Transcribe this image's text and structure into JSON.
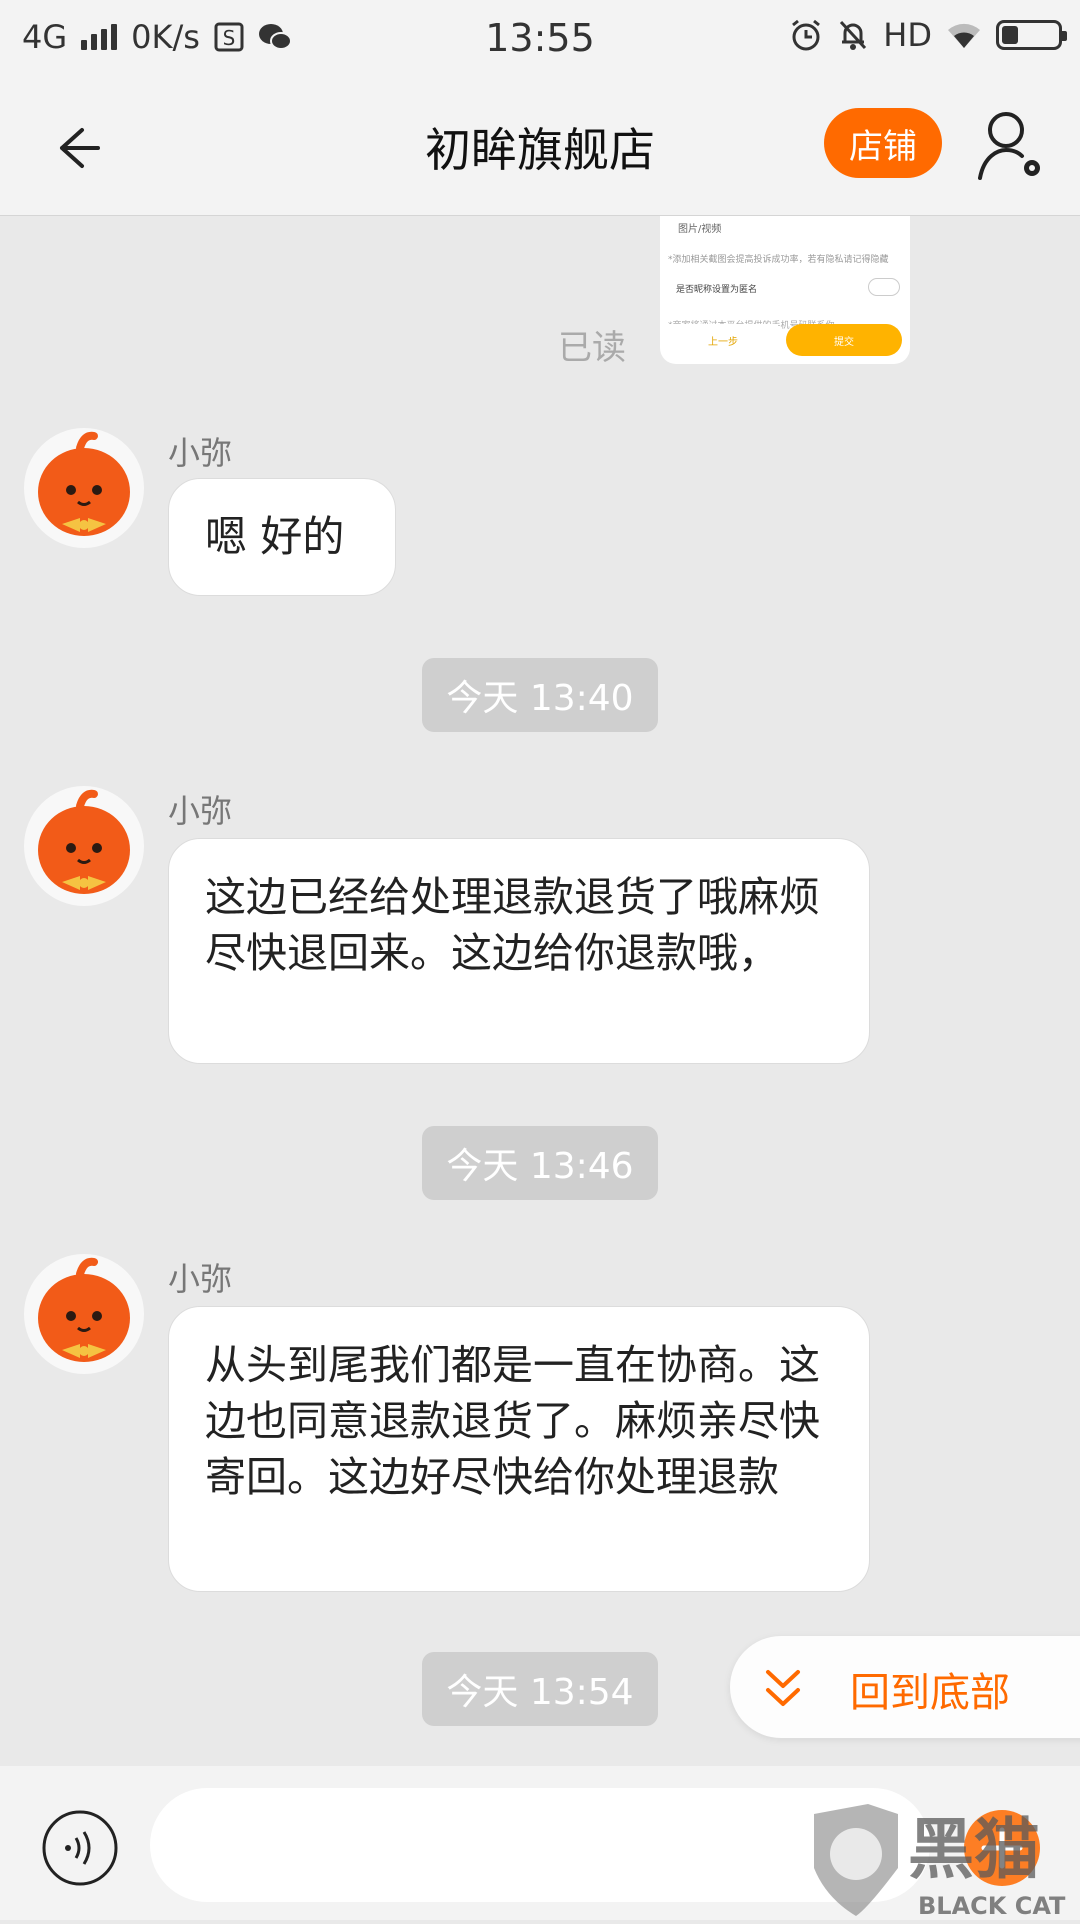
{
  "status_bar": {
    "network": "4G",
    "speed": "0K/s",
    "time": "13:55",
    "hd_label": "HD",
    "icons": [
      "signal-icon",
      "notification-s-icon",
      "wechat-icon",
      "alarm-icon",
      "bell-off-icon",
      "wifi-icon",
      "battery-icon"
    ],
    "battery_level": 0.3
  },
  "header": {
    "title": "初眸旗舰店",
    "shop_button": "店铺",
    "icons": [
      "back-arrow-icon",
      "user-settings-icon"
    ],
    "accent_color": "#ff6a00"
  },
  "preview_image": {
    "row1": "图片/视频",
    "row2": "*添加相关截图会提高投诉成功率，若有隐私请记得隐藏",
    "row3": "是否昵称设置为匿名",
    "row4": "*商家将通过本平台提供的手机号码联系你",
    "prev_button": "上一步",
    "submit_button": "提交"
  },
  "read_status": "已读",
  "messages": [
    {
      "sender": "小弥",
      "text": "嗯 好的"
    },
    {
      "time": "今天  13:40"
    },
    {
      "sender": "小弥",
      "text": "这边已经给处理退款退货了哦麻烦尽快退回来。这边给你退款哦，"
    },
    {
      "time": "今天  13:46"
    },
    {
      "sender": "小弥",
      "text": "从头到尾我们都是一直在协商。这边也同意退款退货了。麻烦亲尽快寄回。这边好尽快给你处理退款"
    },
    {
      "time": "今天  13:54"
    }
  ],
  "back_to_bottom": "回到底部",
  "input": {
    "value": "",
    "placeholder": ""
  },
  "watermark": {
    "text_cn": "黑猫",
    "text_en": "BLACK CAT"
  }
}
